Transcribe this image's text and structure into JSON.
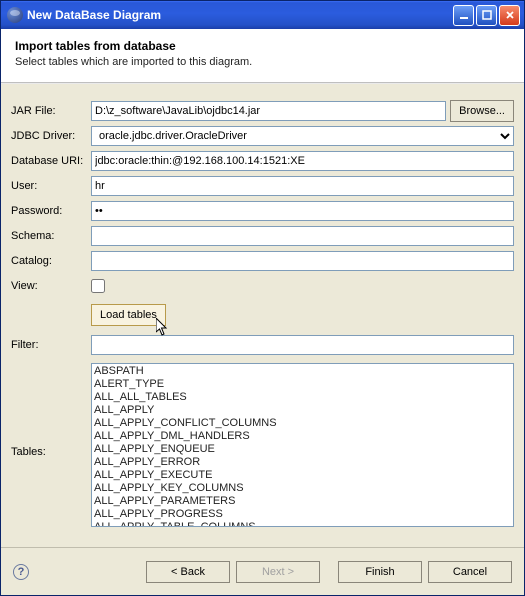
{
  "window": {
    "title": "New DataBase Diagram"
  },
  "header": {
    "title": "Import tables from database",
    "subtitle": "Select tables which are imported to this diagram."
  },
  "labels": {
    "jar_file": "JAR File:",
    "jdbc_driver": "JDBC Driver:",
    "database_uri": "Database URI:",
    "user": "User:",
    "password": "Password:",
    "schema": "Schema:",
    "catalog": "Catalog:",
    "view": "View:",
    "filter": "Filter:",
    "tables": "Tables:"
  },
  "fields": {
    "jar_file": "D:\\z_software\\JavaLib\\ojdbc14.jar",
    "jdbc_driver": "oracle.jdbc.driver.OracleDriver",
    "database_uri": "jdbc:oracle:thin:@192.168.100.14:1521:XE",
    "user": "hr",
    "password": "••",
    "schema": "",
    "catalog": "",
    "view": false,
    "filter": ""
  },
  "buttons": {
    "browse": "Browse...",
    "load_tables": "Load tables",
    "back": "< Back",
    "next": "Next >",
    "finish": "Finish",
    "cancel": "Cancel"
  },
  "tables_list": [
    "ABSPATH",
    "ALERT_TYPE",
    "ALL_ALL_TABLES",
    "ALL_APPLY",
    "ALL_APPLY_CONFLICT_COLUMNS",
    "ALL_APPLY_DML_HANDLERS",
    "ALL_APPLY_ENQUEUE",
    "ALL_APPLY_ERROR",
    "ALL_APPLY_EXECUTE",
    "ALL_APPLY_KEY_COLUMNS",
    "ALL_APPLY_PARAMETERS",
    "ALL_APPLY_PROGRESS",
    "ALL_APPLY_TABLE_COLUMNS"
  ],
  "help_icon": "?"
}
